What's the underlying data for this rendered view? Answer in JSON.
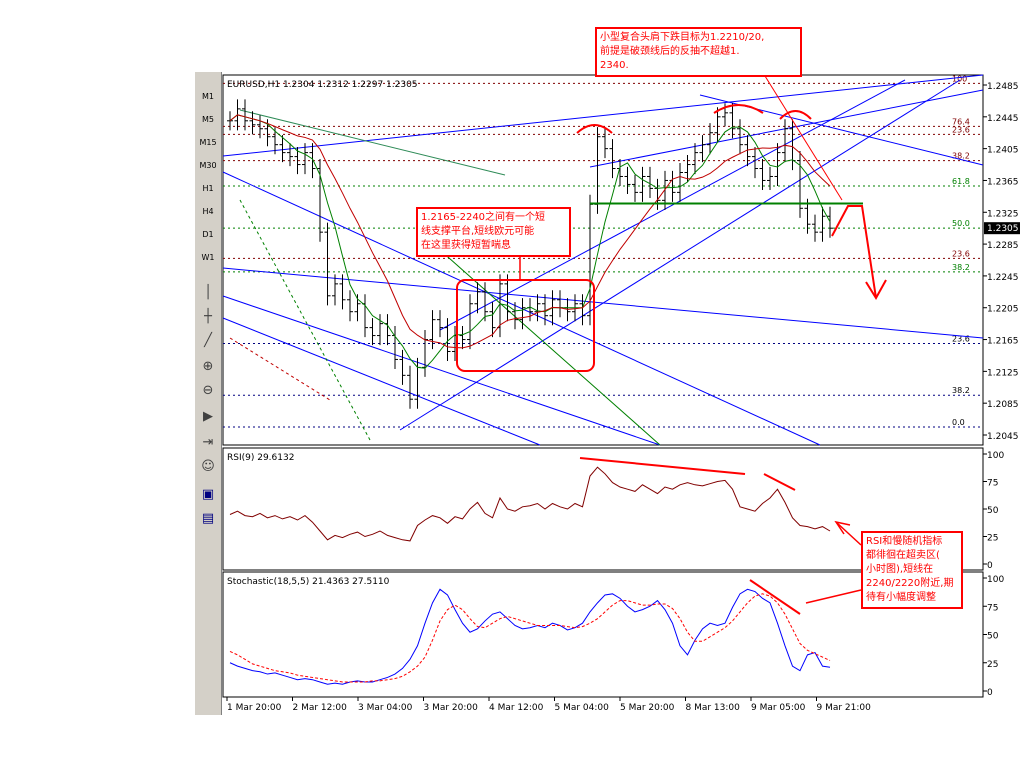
{
  "timeframes": [
    "M1",
    "M5",
    "M15",
    "M30",
    "H1",
    "H4",
    "D1",
    "W1"
  ],
  "tools": [
    {
      "name": "cursor-icon",
      "glyph": "│"
    },
    {
      "name": "crosshair-icon",
      "glyph": "┼"
    },
    {
      "name": "trendline-icon",
      "glyph": "╱"
    },
    {
      "name": "zoom-in-icon",
      "glyph": "⊕"
    },
    {
      "name": "zoom-out-icon",
      "glyph": "⊖"
    },
    {
      "name": "autoscroll-icon",
      "glyph": "▶"
    },
    {
      "name": "chart-shift-icon",
      "glyph": "⇥"
    },
    {
      "name": "expert-icon",
      "glyph": "☺"
    },
    {
      "name": "period-icon",
      "glyph": "▣"
    },
    {
      "name": "template-icon",
      "glyph": "▤"
    }
  ],
  "colors": {
    "price": "#000000",
    "grid": "#c0c0c0",
    "fibo": "#800000",
    "fibo_green": "#008000",
    "rsi": "#800000",
    "stoch_main": "#0000ff",
    "stoch_signal": "#ff0000",
    "ma_fast": "#008000",
    "ma_slow": "#c00000",
    "trend": "#0000ff",
    "annotation": "#ff0000"
  },
  "annotations": {
    "note1": {
      "lines": [
        "小型复合头肩下跌目标为1.2210/20,",
        "前提是破颈线后的反抽不超越1.",
        "2340."
      ]
    },
    "note2": {
      "lines": [
        "1.2165-2240之间有一个短",
        "线支撑平台,短线欧元可能",
        "在这里获得短暂喘息"
      ]
    },
    "note3": {
      "lines": [
        "RSI和慢随机指标",
        "都徘徊在超卖区(",
        "小时图),短线在",
        "2240/2220附近,期",
        "待有小幅度调整"
      ]
    }
  },
  "chart_data": [
    {
      "type": "candlestick",
      "title": "EURUSD,H1 1.2304 1.2312 1.2297 1.2305",
      "symbol": "EURUSD",
      "timeframe": "H1",
      "ohlc_header": {
        "open": 1.2304,
        "high": 1.2312,
        "low": 1.2297,
        "close": 1.2305
      },
      "current_price": "1.2305",
      "ylim": [
        1.2045,
        1.2485
      ],
      "y_ticks": [
        "1.2485",
        "1.2445",
        "1.2405",
        "1.2365",
        "1.2325",
        "1.2285",
        "1.2245",
        "1.2205",
        "1.2165",
        "1.2125",
        "1.2085",
        "1.2045"
      ],
      "x_ticks": [
        "1 Mar 20:00",
        "2 Mar 12:00",
        "3 Mar 04:00",
        "3 Mar 20:00",
        "4 Mar 12:00",
        "5 Mar 04:00",
        "5 Mar 20:00",
        "8 Mar 13:00",
        "9 Mar 05:00",
        "9 Mar 21:00"
      ],
      "fibo_upper": [
        {
          "label": "100",
          "price": 1.2487
        },
        {
          "label": "76.4",
          "price": 1.2433
        },
        {
          "label": "23.6",
          "price": 1.2423
        },
        {
          "label": "38.2",
          "price": 1.239
        },
        {
          "label": "61.8",
          "price": 1.2358
        },
        {
          "label": "50.0",
          "price": 1.2305
        },
        {
          "label": "23.6",
          "price": 1.2267
        },
        {
          "label": "38.2",
          "price": 1.225
        }
      ],
      "fibo_lower": [
        {
          "label": "23.6",
          "price": 1.216
        },
        {
          "label": "38.2",
          "price": 1.2095
        },
        {
          "label": "0.0",
          "price": 1.2055
        }
      ],
      "neckline": 1.2336,
      "series": [
        {
          "name": "close",
          "values": [
            1.244,
            1.2455,
            1.244,
            1.2435,
            1.243,
            1.242,
            1.241,
            1.24,
            1.2395,
            1.2385,
            1.24,
            1.238,
            1.23,
            1.222,
            1.2235,
            1.2215,
            1.22,
            1.221,
            1.218,
            1.217,
            1.2185,
            1.217,
            1.214,
            1.212,
            1.209,
            1.213,
            1.2165,
            1.219,
            1.218,
            1.215,
            1.217,
            1.2165,
            1.221,
            1.2225,
            1.22,
            1.218,
            1.2235,
            1.22,
            1.219,
            1.2205,
            1.22,
            1.221,
            1.2195,
            1.2215,
            1.2205,
            1.22,
            1.221,
            1.2195,
            1.2335,
            1.242,
            1.2405,
            1.238,
            1.237,
            1.236,
            1.235,
            1.237,
            1.2355,
            1.234,
            1.2365,
            1.235,
            1.2375,
            1.2385,
            1.24,
            1.241,
            1.2425,
            1.2445,
            1.245,
            1.243,
            1.241,
            1.2395,
            1.238,
            1.2365,
            1.237,
            1.24,
            1.243,
            1.239,
            1.233,
            1.231,
            1.23,
            1.232,
            1.2305
          ]
        }
      ]
    },
    {
      "type": "line",
      "title": "RSI(9) 29.6132",
      "ylim": [
        0,
        100
      ],
      "y_ticks": [
        "100",
        "75",
        "50",
        "25",
        "0"
      ],
      "series": [
        {
          "name": "RSI(9)",
          "values": [
            45,
            48,
            44,
            43,
            46,
            42,
            44,
            41,
            43,
            40,
            44,
            38,
            30,
            22,
            26,
            24,
            27,
            29,
            25,
            27,
            30,
            26,
            24,
            22,
            21,
            35,
            40,
            44,
            42,
            37,
            43,
            41,
            50,
            56,
            46,
            42,
            60,
            50,
            48,
            52,
            53,
            55,
            50,
            55,
            52,
            50,
            55,
            52,
            80,
            88,
            82,
            74,
            70,
            68,
            66,
            72,
            68,
            64,
            70,
            68,
            72,
            74,
            72,
            71,
            73,
            75,
            76,
            68,
            52,
            50,
            48,
            55,
            60,
            68,
            56,
            42,
            35,
            34,
            32,
            34,
            30
          ]
        }
      ]
    },
    {
      "type": "line",
      "title": "Stochastic(18,5,5) 21.4363 27.5110",
      "ylim": [
        0,
        100
      ],
      "y_ticks": [
        "100",
        "75",
        "50",
        "25",
        "0"
      ],
      "series": [
        {
          "name": "main",
          "values": [
            25,
            22,
            20,
            18,
            17,
            15,
            16,
            14,
            12,
            10,
            11,
            10,
            8,
            6,
            7,
            6,
            8,
            9,
            8,
            8,
            10,
            12,
            15,
            20,
            28,
            40,
            60,
            78,
            90,
            85,
            72,
            60,
            52,
            55,
            62,
            68,
            70,
            64,
            58,
            55,
            56,
            58,
            56,
            60,
            58,
            54,
            56,
            60,
            70,
            78,
            85,
            86,
            82,
            75,
            70,
            72,
            75,
            80,
            72,
            60,
            40,
            32,
            45,
            55,
            60,
            58,
            60,
            74,
            86,
            90,
            88,
            82,
            78,
            60,
            40,
            22,
            18,
            32,
            34,
            22,
            21
          ]
        },
        {
          "name": "signal",
          "values": [
            35,
            32,
            28,
            24,
            22,
            20,
            18,
            17,
            16,
            14,
            13,
            12,
            11,
            10,
            9,
            8,
            8,
            8,
            8,
            9,
            9,
            10,
            11,
            13,
            17,
            22,
            30,
            45,
            62,
            72,
            76,
            72,
            64,
            57,
            56,
            60,
            64,
            66,
            64,
            62,
            60,
            58,
            58,
            58,
            58,
            57,
            56,
            57,
            60,
            64,
            70,
            76,
            80,
            80,
            78,
            76,
            76,
            77,
            77,
            73,
            64,
            52,
            44,
            44,
            48,
            52,
            56,
            62,
            70,
            78,
            84,
            86,
            84,
            78,
            68,
            55,
            42,
            36,
            33,
            30,
            27
          ]
        }
      ]
    }
  ]
}
